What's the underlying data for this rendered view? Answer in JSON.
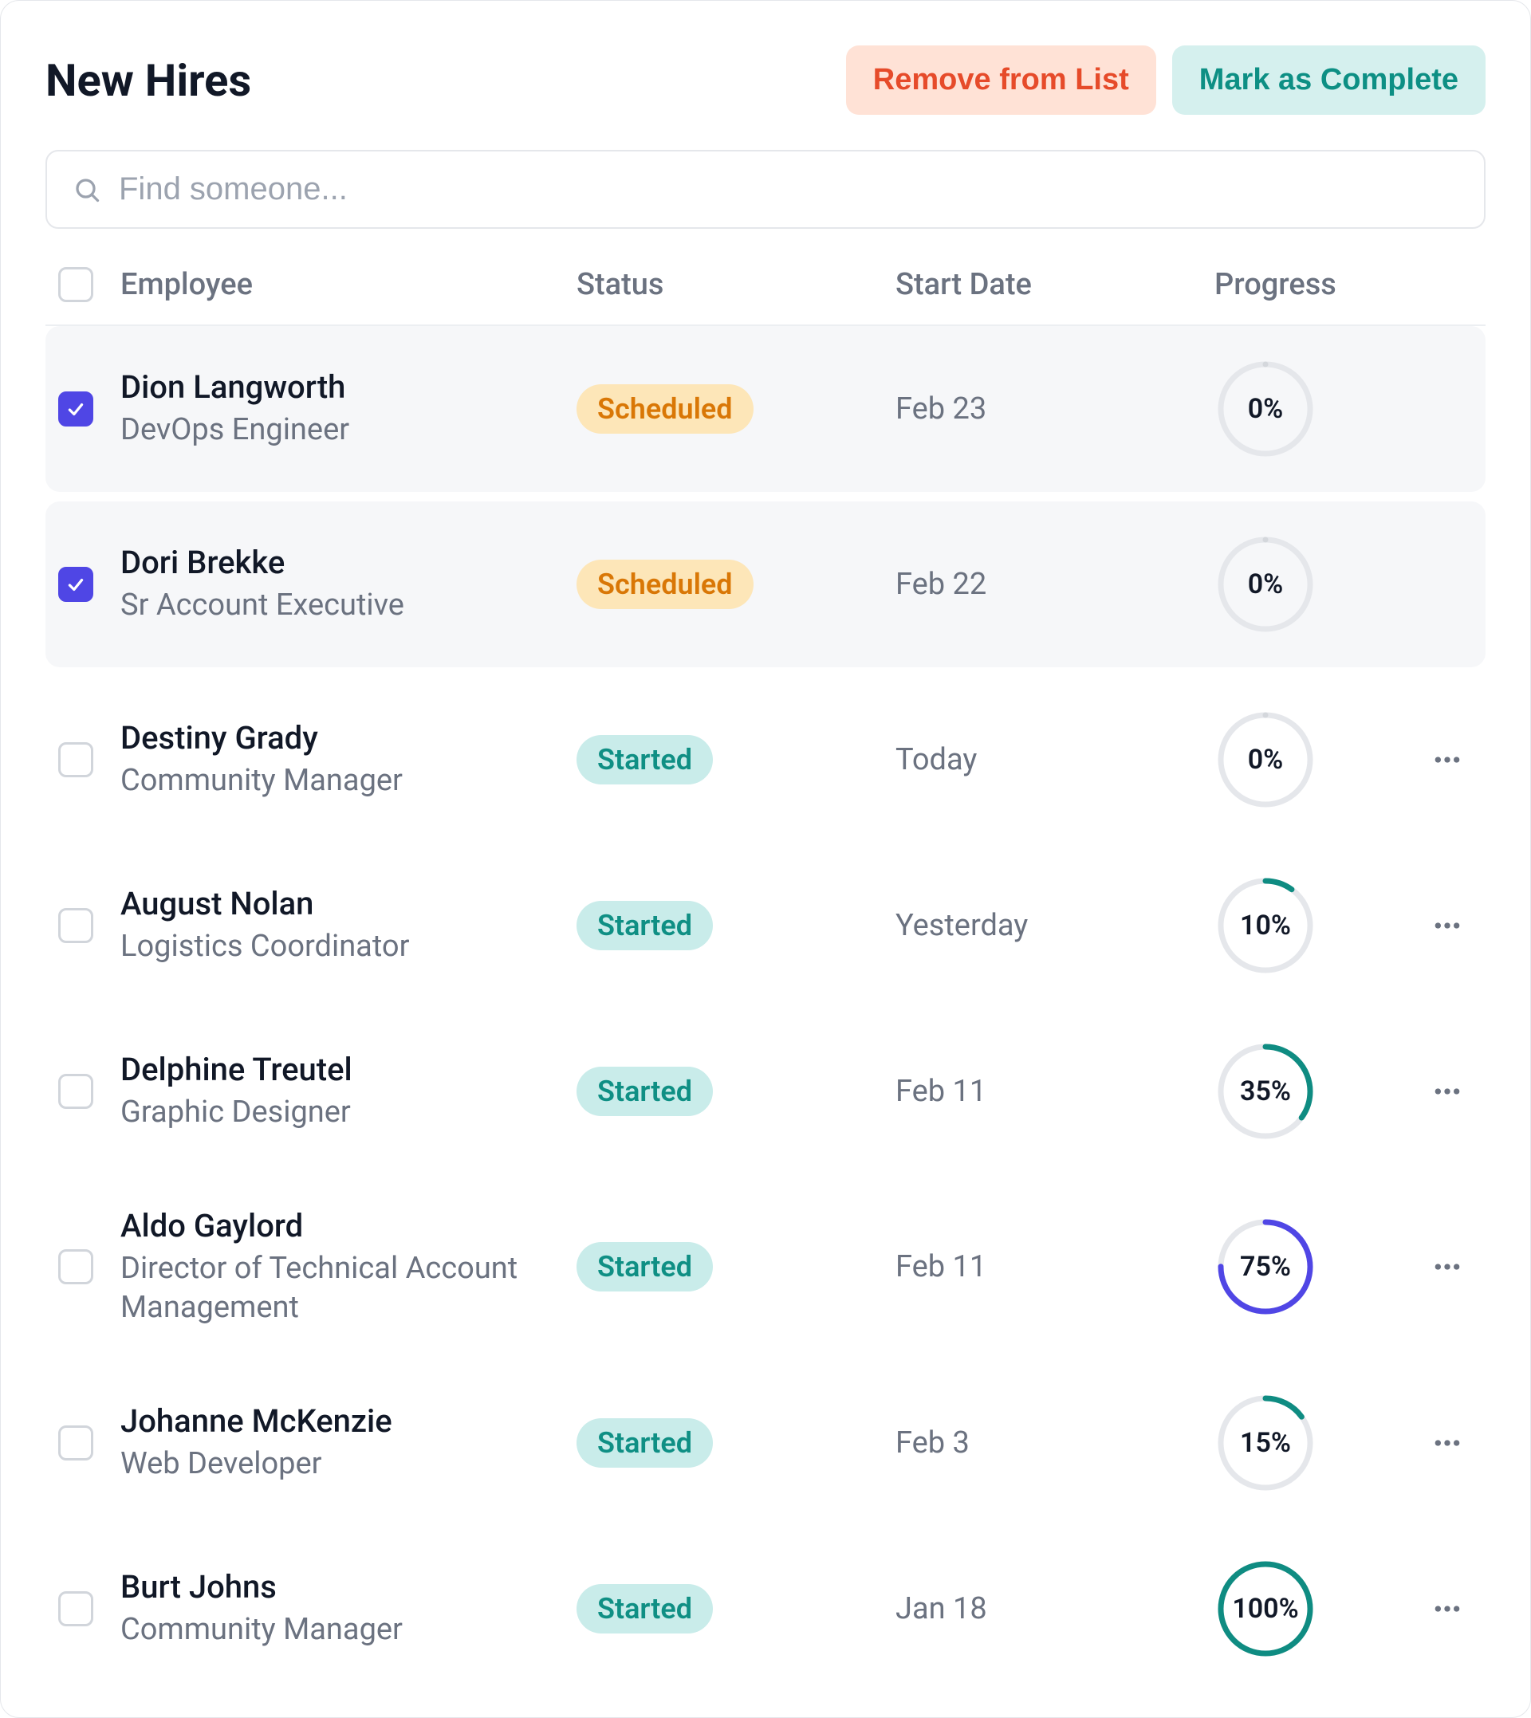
{
  "header": {
    "title": "New Hires",
    "remove_label": "Remove from List",
    "complete_label": "Mark as Complete"
  },
  "search": {
    "placeholder": "Find someone...",
    "value": ""
  },
  "columns": {
    "employee": "Employee",
    "status": "Status",
    "start_date": "Start Date",
    "progress": "Progress"
  },
  "status_labels": {
    "scheduled": "Scheduled",
    "started": "Started"
  },
  "rows": [
    {
      "checked": true,
      "name": "Dion Langworth",
      "title": "DevOps Engineer",
      "status": "scheduled",
      "date": "Feb 23",
      "progress": 0,
      "ring_color": "gray",
      "show_more": false
    },
    {
      "checked": true,
      "name": "Dori Brekke",
      "title": "Sr Account Executive",
      "status": "scheduled",
      "date": "Feb 22",
      "progress": 0,
      "ring_color": "gray",
      "show_more": false
    },
    {
      "checked": false,
      "name": "Destiny Grady",
      "title": "Community Manager",
      "status": "started",
      "date": "Today",
      "progress": 0,
      "ring_color": "gray",
      "show_more": true
    },
    {
      "checked": false,
      "name": "August Nolan",
      "title": "Logistics Coordinator",
      "status": "started",
      "date": "Yesterday",
      "progress": 10,
      "ring_color": "teal",
      "show_more": true
    },
    {
      "checked": false,
      "name": "Delphine Treutel",
      "title": "Graphic Designer",
      "status": "started",
      "date": "Feb 11",
      "progress": 35,
      "ring_color": "teal",
      "show_more": true
    },
    {
      "checked": false,
      "name": "Aldo Gaylord",
      "title": "Director of Technical Account Management",
      "status": "started",
      "date": "Feb 11",
      "progress": 75,
      "ring_color": "indigo",
      "show_more": true
    },
    {
      "checked": false,
      "name": "Johanne McKenzie",
      "title": "Web Developer",
      "status": "started",
      "date": "Feb 3",
      "progress": 15,
      "ring_color": "teal",
      "show_more": true
    },
    {
      "checked": false,
      "name": "Burt Johns",
      "title": "Community Manager",
      "status": "started",
      "date": "Jan 18",
      "progress": 100,
      "ring_color": "teal",
      "show_more": true
    }
  ]
}
